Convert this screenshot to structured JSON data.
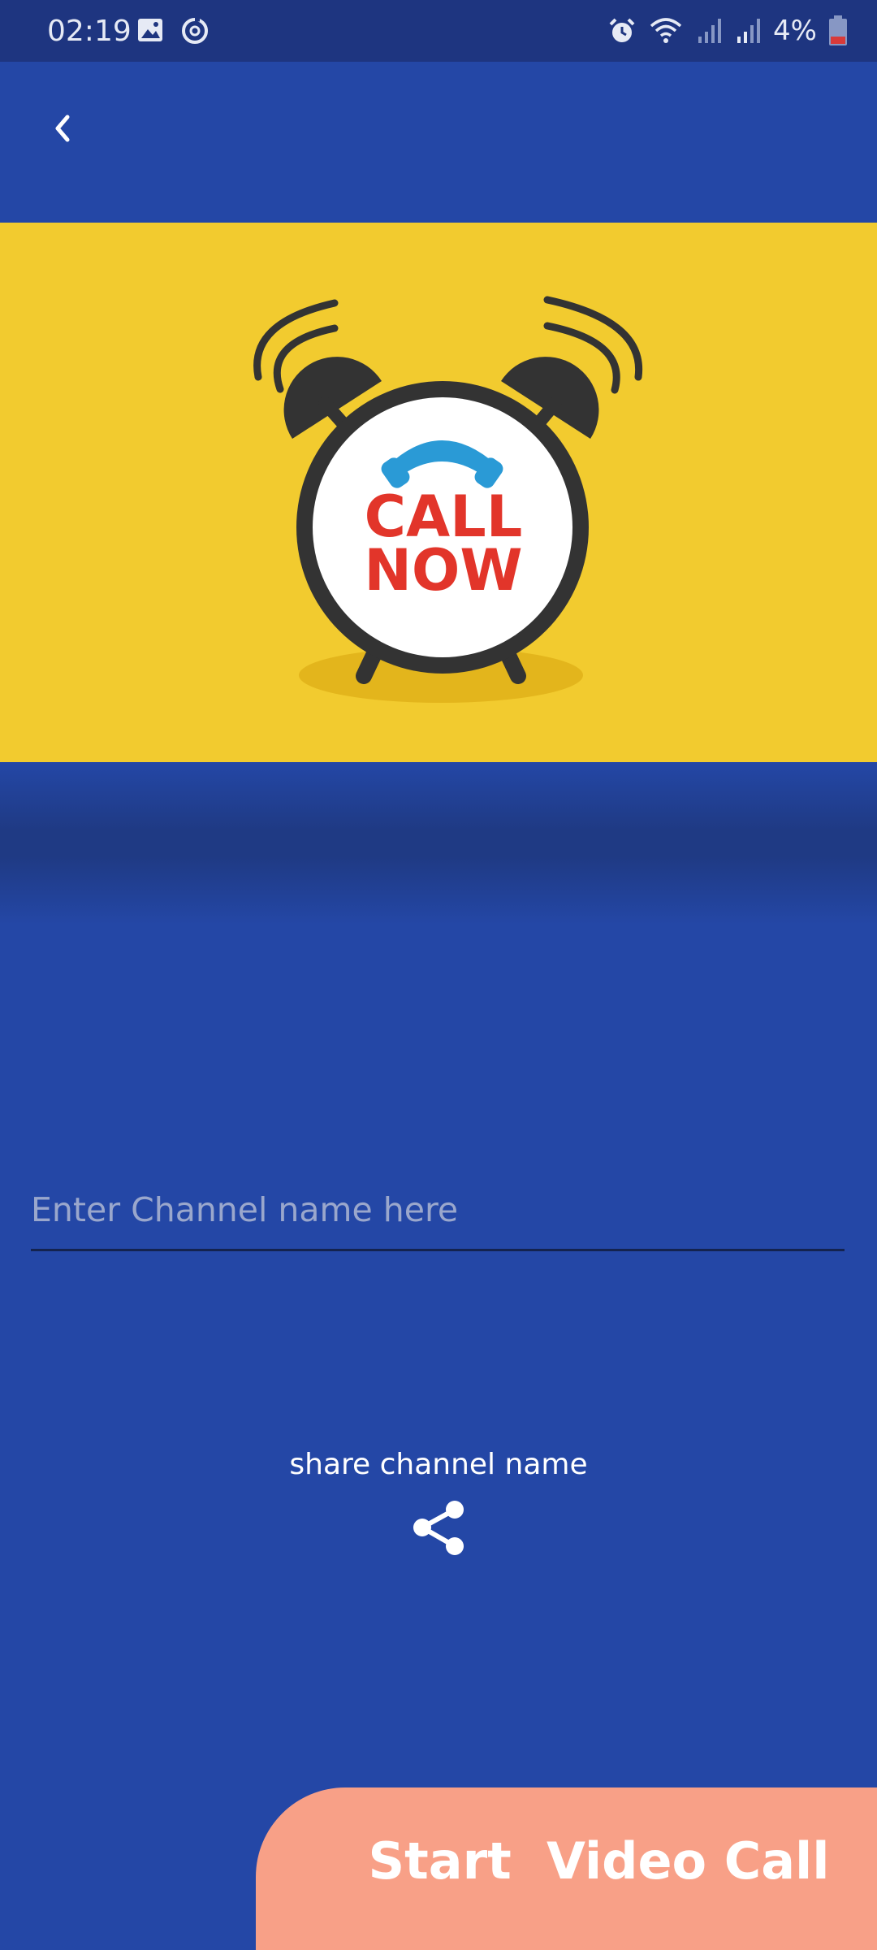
{
  "status_bar": {
    "time": "02:19",
    "battery": "4%",
    "icons": [
      "image-icon",
      "sync-icon",
      "alarm-icon",
      "wifi-icon",
      "signal-icon",
      "signal-icon",
      "battery-low-icon"
    ]
  },
  "app_bar": {
    "back_icon": "chevron-left-icon"
  },
  "banner": {
    "line1": "CALL",
    "line2": "NOW",
    "colors": {
      "background": "#f2cb2f",
      "text": "#e2352a",
      "handset": "#2a9ad6",
      "clock": "#333333"
    }
  },
  "channel": {
    "placeholder": "Enter Channel name here",
    "value": ""
  },
  "share": {
    "label": "share channel name",
    "icon": "share-icon"
  },
  "actions": {
    "start_call": "Start  Video Call"
  },
  "colors": {
    "primary": "#2447a6",
    "status_bar": "#1e3580",
    "accent": "#f8a087"
  }
}
